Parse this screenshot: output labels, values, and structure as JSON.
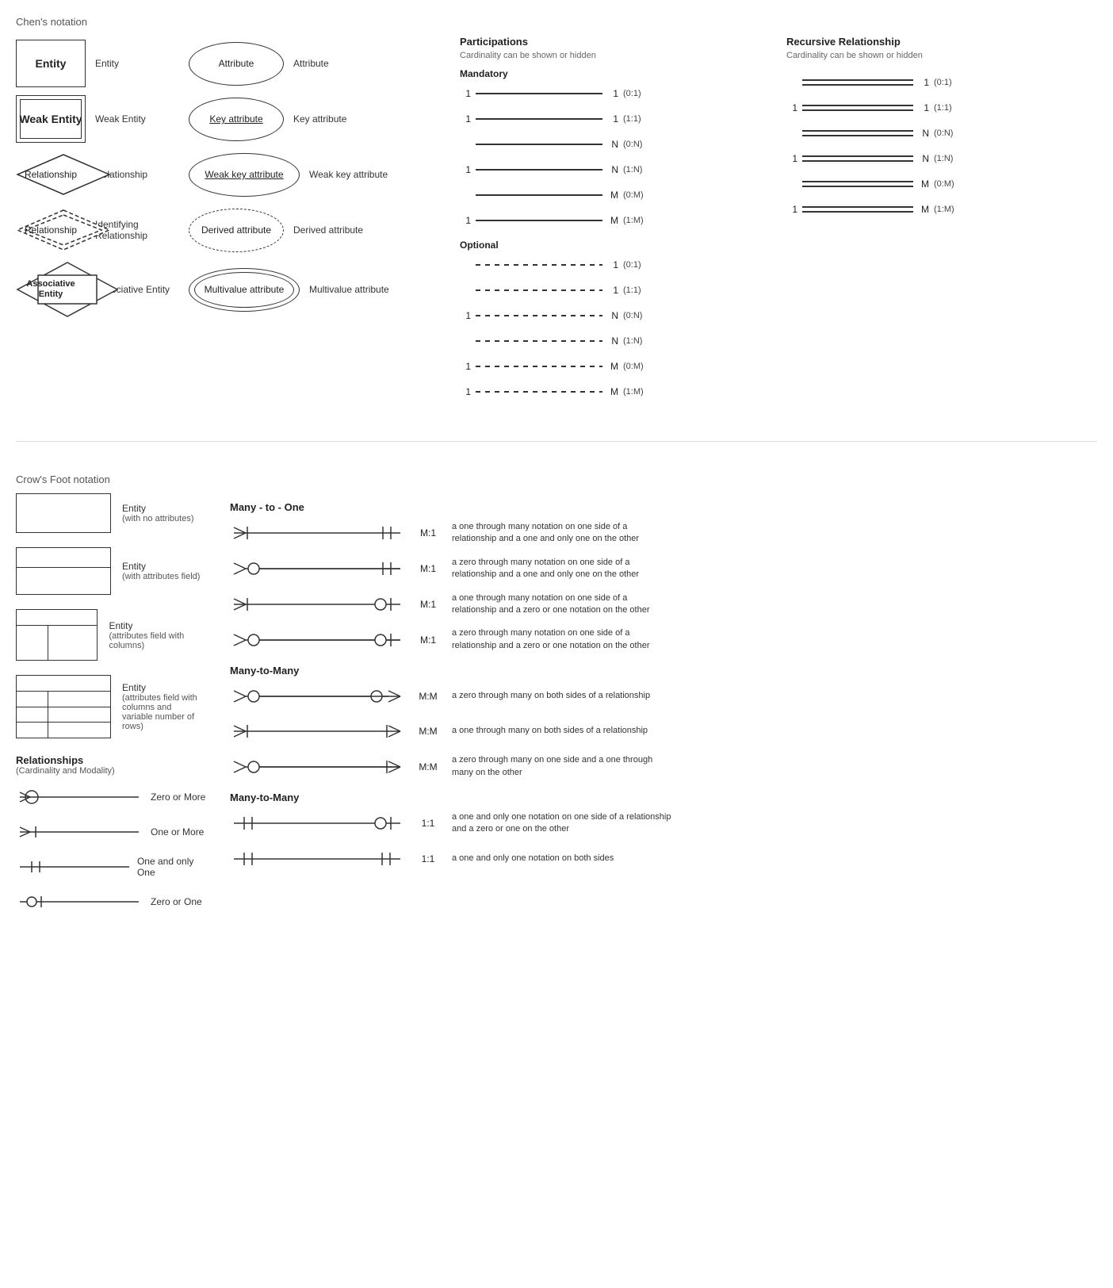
{
  "sections": {
    "chen_title": "Chen's notation",
    "crowsfoot_title": "Crow's Foot notation"
  },
  "chen": {
    "entities": [
      {
        "label": "Entity",
        "desc": "Entity"
      },
      {
        "label": "Weak Entity",
        "desc": "Weak Entity"
      },
      {
        "label": "Relationship",
        "desc": "Relationship"
      },
      {
        "label": "Relationship",
        "desc": "Identifying Relationship"
      },
      {
        "label": "Associative\nEntity",
        "desc": "Associative Entity"
      }
    ],
    "attributes": [
      {
        "label": "Attribute",
        "desc": "Attribute"
      },
      {
        "label": "Key attribute",
        "desc": "Key attribute",
        "underline": true
      },
      {
        "label": "Weak key attribute",
        "desc": "Weak key attribute",
        "underline": true
      },
      {
        "label": "Derived attribute",
        "desc": "Derived attribute",
        "dashed": true
      },
      {
        "label": "Multivalue attribute",
        "desc": "Multivalue attribute",
        "double": true
      }
    ]
  },
  "participation": {
    "title": "Participations",
    "subtitle": "Cardinality can be shown or hidden",
    "mandatory_title": "Mandatory",
    "mandatory_rows": [
      {
        "left": "1",
        "right": "1",
        "notation": "(0:1)"
      },
      {
        "left": "1",
        "right": "1",
        "notation": "(1:1)"
      },
      {
        "left": "",
        "right": "N",
        "notation": "(0:N)"
      },
      {
        "left": "1",
        "right": "N",
        "notation": "(1:N)"
      },
      {
        "left": "",
        "right": "M",
        "notation": "(0:M)"
      },
      {
        "left": "1",
        "right": "M",
        "notation": "(1:M)"
      }
    ],
    "optional_title": "Optional",
    "optional_rows": [
      {
        "left": "",
        "right": "1",
        "notation": "(0:1)"
      },
      {
        "left": "",
        "right": "1",
        "notation": "(1:1)"
      },
      {
        "left": "1",
        "right": "N",
        "notation": "(0:N)"
      },
      {
        "left": "",
        "right": "N",
        "notation": "(1:N)"
      },
      {
        "left": "1",
        "right": "M",
        "notation": "(0:M)"
      },
      {
        "left": "1",
        "right": "M",
        "notation": "(1:M)"
      }
    ]
  },
  "recursive": {
    "title": "Recursive Relationship",
    "subtitle": "Cardinality can be shown or hidden",
    "rows": [
      {
        "left": "",
        "right": "1",
        "notation": "(0:1)"
      },
      {
        "left": "1",
        "right": "1",
        "notation": "(1:1)"
      },
      {
        "left": "",
        "right": "N",
        "notation": "(0:N)"
      },
      {
        "left": "1",
        "right": "N",
        "notation": "(1:N)"
      },
      {
        "left": "",
        "right": "M",
        "notation": "(0:M)"
      },
      {
        "left": "1",
        "right": "M",
        "notation": "(1:M)"
      }
    ]
  },
  "crowsfoot": {
    "shapes": [
      {
        "type": "simple",
        "label": "Entity",
        "sublabel": "(with no attributes)"
      },
      {
        "type": "attrs",
        "label": "Entity",
        "sublabel": "(with attributes field)"
      },
      {
        "type": "cols",
        "label": "Entity",
        "sublabel": "(attributes field with columns)"
      },
      {
        "type": "rows",
        "label": "Entity",
        "sublabel": "(attributes field with columns and\nvariable number of rows)"
      }
    ],
    "relationships_title": "Relationships",
    "relationships_subtitle": "(Cardinality and Modality)",
    "rel_symbols": [
      {
        "type": "zero-or-more",
        "label": "Zero or More"
      },
      {
        "type": "one-or-more",
        "label": "One or More"
      },
      {
        "type": "one-only",
        "label": "One and only One"
      },
      {
        "type": "zero-or-one",
        "label": "Zero or One"
      }
    ],
    "many_to_one_title": "Many - to - One",
    "many_to_one": [
      {
        "left": "one-or-more",
        "label": "M:1",
        "right": "one-only",
        "desc": "a one through many notation on one side of a relationship and a one and only one on the other"
      },
      {
        "left": "zero-or-more",
        "label": "M:1",
        "right": "one-only",
        "desc": "a zero through many notation on one side of a relationship and a one and only one on the other"
      },
      {
        "left": "one-or-more",
        "label": "M:1",
        "right": "zero-or-one",
        "desc": "a one through many notation on one side of a relationship and a zero or one notation on the other"
      },
      {
        "left": "zero-or-more",
        "label": "M:1",
        "right": "zero-or-one",
        "desc": "a zero through many notation on one side of a relationship and a zero or one notation on the other"
      }
    ],
    "many_to_many_title": "Many-to-Many",
    "many_to_many": [
      {
        "left": "zero-or-more",
        "label": "M:M",
        "right": "zero-or-more-r",
        "desc": "a zero through many on both sides of a relationship"
      },
      {
        "left": "one-or-more",
        "label": "M:M",
        "right": "one-or-more-r",
        "desc": "a one through many on both sides of a relationship"
      },
      {
        "left": "zero-or-more",
        "label": "M:M",
        "right": "one-or-more-r",
        "desc": "a zero through many on one side and a one through many on the other"
      }
    ],
    "many_to_many2_title": "Many-to-Many",
    "one_to_one": [
      {
        "left": "one-only",
        "label": "1:1",
        "right": "zero-or-one",
        "desc": "a one and only one notation on one side of a relationship and a zero or one on the other"
      },
      {
        "left": "one-only",
        "label": "1:1",
        "right": "one-only",
        "desc": "a one and only one notation on both sides"
      }
    ]
  }
}
